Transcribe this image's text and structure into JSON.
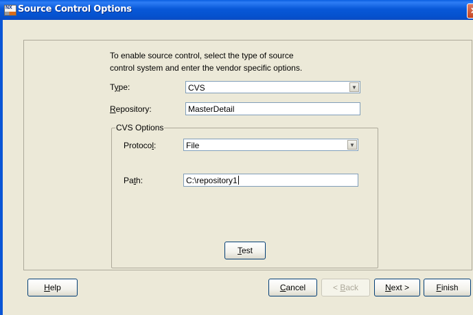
{
  "window": {
    "title": "Source Control Options",
    "icon_text": "NX",
    "close_glyph": "✕"
  },
  "intro": {
    "line1": "To enable source control, select the type of source",
    "line2": "control system and enter the vendor specific options."
  },
  "type": {
    "label_pre": "T",
    "label_mnemonic": "y",
    "label_post": "pe:",
    "value": "CVS"
  },
  "repository": {
    "label_mnemonic": "R",
    "label_post": "epository:",
    "value": "MasterDetail"
  },
  "cvs_options": {
    "legend": "CVS Options",
    "protocol": {
      "label_pre": "Protoco",
      "label_mnemonic": "l",
      "label_post": ":",
      "value": "File"
    },
    "path": {
      "label_pre": "Pa",
      "label_mnemonic": "t",
      "label_post": "h:",
      "value": "C:\\repository1"
    },
    "test_button": {
      "mnemonic": "T",
      "rest": "est"
    }
  },
  "buttons": {
    "help": {
      "mnemonic": "H",
      "rest": "elp"
    },
    "cancel": {
      "mnemonic": "C",
      "rest": "ancel"
    },
    "back": {
      "pre": "< ",
      "mnemonic": "B",
      "rest": "ack"
    },
    "next": {
      "mnemonic": "N",
      "rest": "ext >"
    },
    "finish": {
      "mnemonic": "F",
      "rest": "inish"
    }
  },
  "colors": {
    "titlebar": "#0a5fe0",
    "dialog_bg": "#ece9d8",
    "field_border": "#7f9db9"
  },
  "icons": [
    "app-icon",
    "close-icon",
    "dropdown-arrow-icon"
  ]
}
